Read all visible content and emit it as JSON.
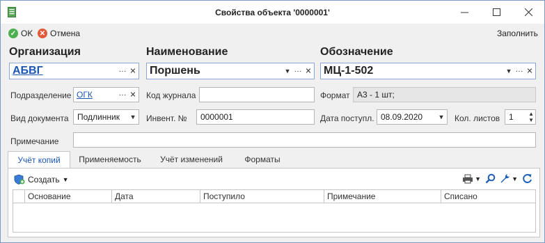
{
  "window": {
    "title": "Свойства объекта '0000001'"
  },
  "toolbar": {
    "ok_label": "OK",
    "cancel_label": "Отмена",
    "fill_label": "Заполнить"
  },
  "form": {
    "organization": {
      "label": "Организация",
      "value": "АБВГ"
    },
    "name": {
      "label": "Наименование",
      "value": "Поршень"
    },
    "designation": {
      "label": "Обозначение",
      "value": "МЦ-1-502"
    },
    "department": {
      "label": "Подразделение",
      "value": "ОГК"
    },
    "journal_code": {
      "label": "Код журнала",
      "value": ""
    },
    "format": {
      "label": "Формат",
      "value": "А3 - 1 шт;"
    },
    "doc_type": {
      "label": "Вид документа",
      "value": "Подлинник"
    },
    "inventory": {
      "label": "Инвент. №",
      "value": "0000001"
    },
    "receipt_date": {
      "label": "Дата поступл.",
      "value": "08.09.2020"
    },
    "sheet_count": {
      "label": "Кол. листов",
      "value": "1"
    },
    "note": {
      "label": "Примечание",
      "value": ""
    }
  },
  "tabs": [
    {
      "label": "Учёт копий"
    },
    {
      "label": "Применяемость"
    },
    {
      "label": "Учёт изменений"
    },
    {
      "label": "Форматы"
    }
  ],
  "grid": {
    "create_label": "Создать",
    "columns": [
      "Основание",
      "Дата",
      "Поступило",
      "Примечание",
      "Списано"
    ]
  },
  "colors": {
    "accent": "#1a56b6",
    "ok": "#4caf50",
    "cancel": "#e05a3a"
  }
}
